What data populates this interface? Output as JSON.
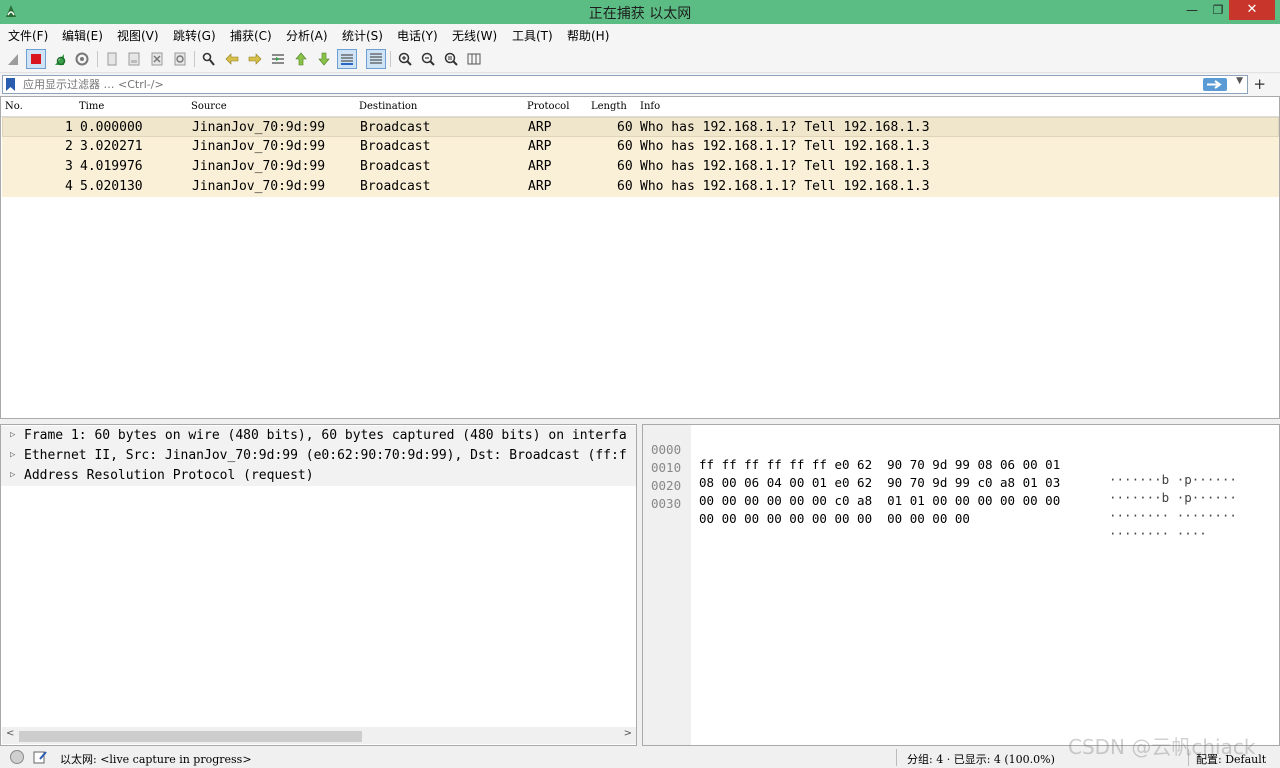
{
  "window": {
    "title": "正在捕获 以太网",
    "minimize": "—",
    "maximize": "❐",
    "close": "✕"
  },
  "menu": [
    "文件(F)",
    "编辑(E)",
    "视图(V)",
    "跳转(G)",
    "捕获(C)",
    "分析(A)",
    "统计(S)",
    "电话(Y)",
    "无线(W)",
    "工具(T)",
    "帮助(H)"
  ],
  "filter": {
    "placeholder": "应用显示过滤器 … <Ctrl-/>",
    "value": "",
    "add_label": "+"
  },
  "packet_list": {
    "columns": [
      "No.",
      "Time",
      "Source",
      "Destination",
      "Protocol",
      "Length",
      "Info"
    ],
    "rows": [
      {
        "no": "1",
        "time": "0.000000",
        "source": "JinanJov_70:9d:99",
        "destination": "Broadcast",
        "protocol": "ARP",
        "length": "60",
        "info": "Who has 192.168.1.1? Tell 192.168.1.3"
      },
      {
        "no": "2",
        "time": "3.020271",
        "source": "JinanJov_70:9d:99",
        "destination": "Broadcast",
        "protocol": "ARP",
        "length": "60",
        "info": "Who has 192.168.1.1? Tell 192.168.1.3"
      },
      {
        "no": "3",
        "time": "4.019976",
        "source": "JinanJov_70:9d:99",
        "destination": "Broadcast",
        "protocol": "ARP",
        "length": "60",
        "info": "Who has 192.168.1.1? Tell 192.168.1.3"
      },
      {
        "no": "4",
        "time": "5.020130",
        "source": "JinanJov_70:9d:99",
        "destination": "Broadcast",
        "protocol": "ARP",
        "length": "60",
        "info": "Who has 192.168.1.1? Tell 192.168.1.3"
      }
    ],
    "row_color": "#faf0d7"
  },
  "details": [
    "Frame 1: 60 bytes on wire (480 bits), 60 bytes captured (480 bits) on interfa",
    "Ethernet II, Src: JinanJov_70:9d:99 (e0:62:90:70:9d:99), Dst: Broadcast (ff:f",
    "Address Resolution Protocol (request)"
  ],
  "bytes": [
    {
      "offset": "0000",
      "hex": "ff ff ff ff ff ff e0 62  90 70 9d 99 08 06 00 01",
      "ascii": "·······b ·p······"
    },
    {
      "offset": "0010",
      "hex": "08 00 06 04 00 01 e0 62  90 70 9d 99 c0 a8 01 03",
      "ascii": "·······b ·p······"
    },
    {
      "offset": "0020",
      "hex": "00 00 00 00 00 00 c0 a8  01 01 00 00 00 00 00 00",
      "ascii": "········ ········"
    },
    {
      "offset": "0030",
      "hex": "00 00 00 00 00 00 00 00  00 00 00 00",
      "ascii": "········ ····"
    }
  ],
  "status": {
    "capture": "以太网: <live capture in progress>",
    "packets": "分组: 4 · 已显示: 4 (100.0%)",
    "profile": "配置: Default"
  },
  "watermark": "CSDN @云帆chiack",
  "colors": {
    "titlebar": "#5bbd84",
    "close": "#c7352b",
    "packet_row": "#faf0d7"
  }
}
